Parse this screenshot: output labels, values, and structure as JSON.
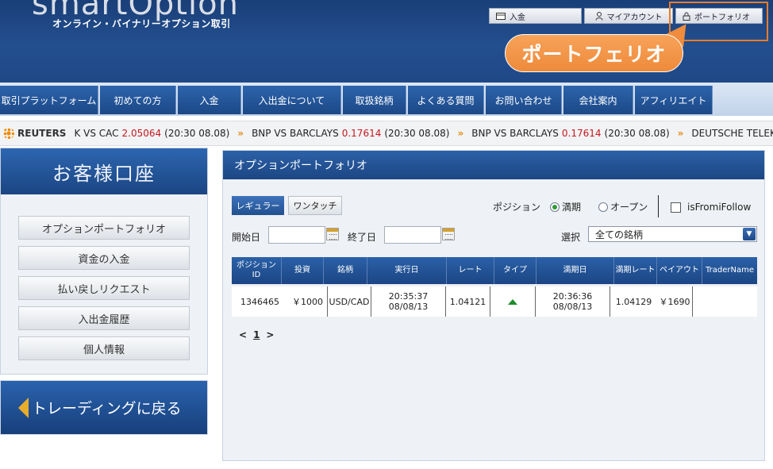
{
  "header": {
    "logo_text": "smartOption",
    "tagline": "オンライン・バイナリーオプション取引",
    "top_buttons": {
      "deposit": "入金",
      "my_account": "マイアカウント",
      "portfolio": "ポートフォリオ"
    },
    "callout": "ポートフェリオ",
    "colors": {
      "header": "#1f4886",
      "callout": "#ee8a3a"
    }
  },
  "nav": {
    "items": [
      "取引プラットフォーム",
      "初めての方",
      "入金",
      "入出金について",
      "取扱銘柄",
      "よくある質問",
      "お問い合わせ",
      "会社案内",
      "アフィリエイト"
    ]
  },
  "ticker": {
    "brand": "REUTERS",
    "items": [
      {
        "pair": "K VS CAC",
        "value": "2.05064",
        "time": "(20:30 08.08)"
      },
      {
        "pair": "BNP VS BARCLAYS",
        "value": "0.17614",
        "time": "(20:30 08.08)"
      },
      {
        "pair": "BNP VS BARCLAYS",
        "value": "0.17614",
        "time": "(20:30 08.08)"
      },
      {
        "pair": "DEUTSCHE TELEKOM",
        "value": "",
        "time": ""
      }
    ]
  },
  "sidebar": {
    "title": "お客様口座",
    "items": [
      "オプションポートフォリオ",
      "資金の入金",
      "払い戻しリクエスト",
      "入出金履歴",
      "個人情報"
    ],
    "back_label": "トレーディングに戻る"
  },
  "panel": {
    "title": "オプションポートフォリオ",
    "tabs": {
      "regular": "レギュラー",
      "one_touch": "ワンタッチ"
    },
    "position_label": "ポジション",
    "radio_expired": "満期",
    "radio_open": "オープン",
    "checkbox_label": "isFromiFollow",
    "start_label": "開始日",
    "end_label": "終了日",
    "start_value": "",
    "end_value": "",
    "select_label": "選択",
    "select_value": "全ての銘柄",
    "columns": [
      "ポジション ID",
      "投資",
      "銘柄",
      "実行日",
      "レート",
      "タイプ",
      "満期日",
      "満期レート",
      "ペイアウト",
      "TraderName"
    ],
    "rows": [
      {
        "id": "1346465",
        "investment": "￥1000",
        "asset": "USD/CAD",
        "exec_time": "20:35:37",
        "exec_date": "08/08/13",
        "rate": "1.04121",
        "type_icon": "up-arrow-icon",
        "exp_time": "20:36:36",
        "exp_date": "08/08/13",
        "exp_rate": "1.04129",
        "payout": "￥1690",
        "trader": ""
      }
    ],
    "pager": {
      "prev": "<",
      "current": "1",
      "next": ">"
    }
  }
}
